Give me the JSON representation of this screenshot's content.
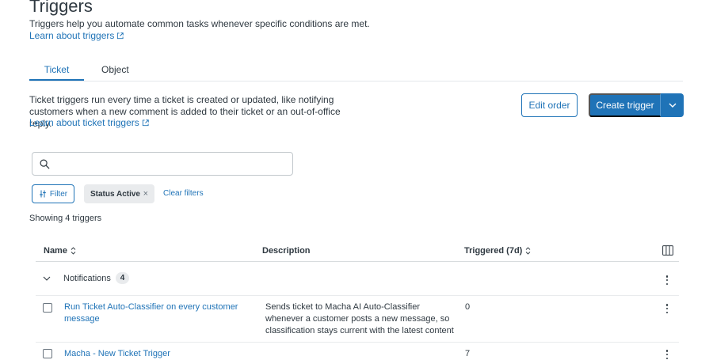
{
  "header": {
    "title": "Triggers",
    "subtitle": "Triggers help you automate common tasks whenever specific conditions are met.",
    "learn_link": "Learn about triggers"
  },
  "tabs": [
    {
      "label": "Ticket",
      "active": true
    },
    {
      "label": "Object",
      "active": false
    }
  ],
  "section": {
    "description": "Ticket triggers run every time a ticket is created or updated, like notifying customers when a new comment is added to their ticket or an out-of-office reply.",
    "learn_link": "Learn about ticket triggers"
  },
  "actions": {
    "edit_order": "Edit order",
    "create_trigger": "Create trigger"
  },
  "search": {
    "value": "",
    "placeholder": ""
  },
  "filters": {
    "filter_button": "Filter",
    "chip_label": "Status Active",
    "chip_close": "×",
    "clear": "Clear filters"
  },
  "count_text": "Showing 4 triggers",
  "table": {
    "columns": [
      "Name",
      "Description",
      "Triggered (7d)"
    ],
    "group": {
      "label": "Notifications",
      "count": "4"
    },
    "rows": [
      {
        "name": "Run Ticket Auto-Classifier on every customer message",
        "description": "Sends ticket to Macha AI Auto-Classifier whenever a customer posts a new message, so classification stays current with the latest content",
        "triggered": "0"
      },
      {
        "name": "Macha - New Ticket Trigger",
        "description": "",
        "triggered": "7"
      }
    ]
  },
  "colors": {
    "primary": "#1f73b7",
    "text": "#2f3941",
    "border": "#d8dcde",
    "chip_bg": "#e9ebed"
  }
}
